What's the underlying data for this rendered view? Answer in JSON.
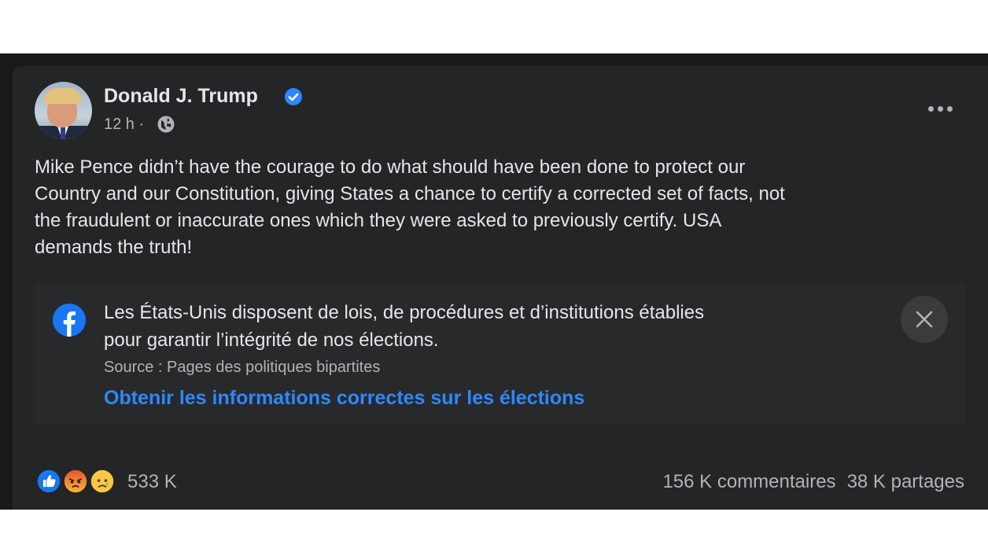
{
  "post": {
    "author": "Donald J. Trump",
    "verified_icon": "verified-badge-icon",
    "time": "12 h",
    "separator": "·",
    "privacy_icon": "globe-icon",
    "more_icon": "more-options-icon",
    "text_lines": [
      "Mike Pence didn’t have the courage to do what should have been done to protect our",
      "Country and our Constitution, giving States a chance to certify a corrected set of facts, not",
      "the fraudulent or inaccurate ones which they were asked to previously certify. USA",
      "demands the truth!"
    ]
  },
  "info_panel": {
    "logo_icon": "facebook-logo-icon",
    "lines": [
      "Les États-Unis disposent de lois, de procédures et d’institutions établies",
      "pour garantir l’intégrité de nos élections."
    ],
    "source": "Source : Pages des politiques bipartites",
    "link": "Obtenir les informations correctes sur les élections",
    "close_icon": "close-icon"
  },
  "footer": {
    "reaction_icons": [
      "like-reaction-icon",
      "angry-reaction-icon",
      "sad-reaction-icon"
    ],
    "reaction_count": "533 K",
    "comments": "156 K commentaires",
    "shares": "38 K partages"
  },
  "colors": {
    "card_background": "#242526",
    "primary_text": "#e4e6eb",
    "secondary_text": "#b0b3b8",
    "link": "#2d88ff",
    "verified": "#2d88ff"
  }
}
